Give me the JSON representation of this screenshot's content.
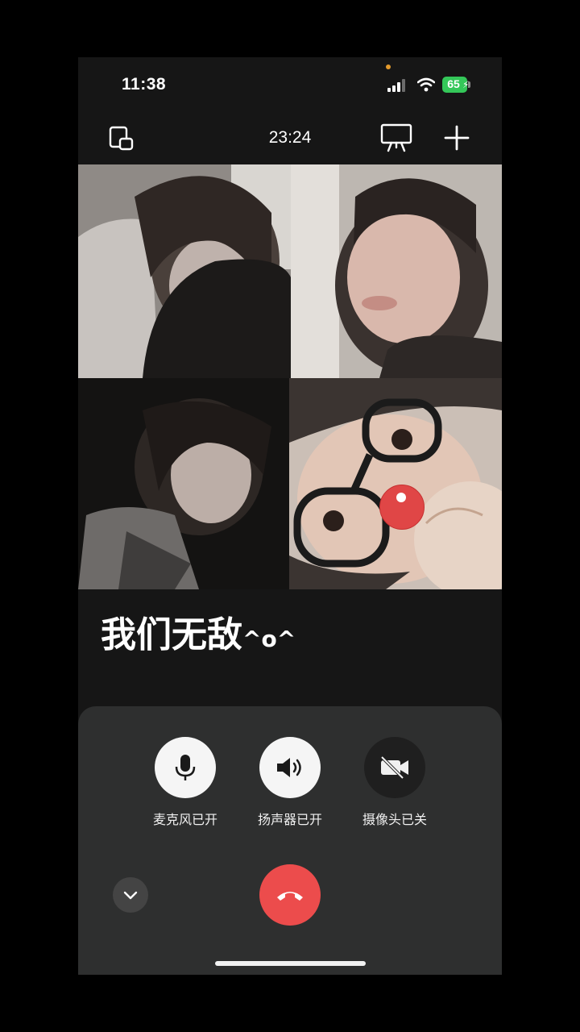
{
  "status_bar": {
    "time": "11:38",
    "battery_level": "65",
    "icons": [
      "signal-icon",
      "wifi-icon",
      "battery-charging-icon"
    ]
  },
  "top_bar": {
    "call_duration": "23:24",
    "icons": [
      "minimize-window-icon",
      "screen-share-icon",
      "add-participant-icon"
    ]
  },
  "participants": [
    {
      "position": "top-left"
    },
    {
      "position": "top-right"
    },
    {
      "position": "bottom-left"
    },
    {
      "position": "bottom-right"
    }
  ],
  "caption": {
    "text": "我们无敌",
    "emoticon": "^o^"
  },
  "controls": {
    "mic": {
      "label": "麦克风已开",
      "icon": "microphone-icon"
    },
    "speaker": {
      "label": "扬声器已开",
      "icon": "speaker-icon"
    },
    "camera": {
      "label": "摄像头已关",
      "icon": "camera-off-icon"
    },
    "collapse_icon": "chevron-down-icon",
    "hangup_icon": "hang-up-icon"
  },
  "colors": {
    "hangup": "#ec4c4c",
    "battery": "#34c759",
    "panel": "#2e2f2f",
    "recording_dot": "#e04646"
  }
}
